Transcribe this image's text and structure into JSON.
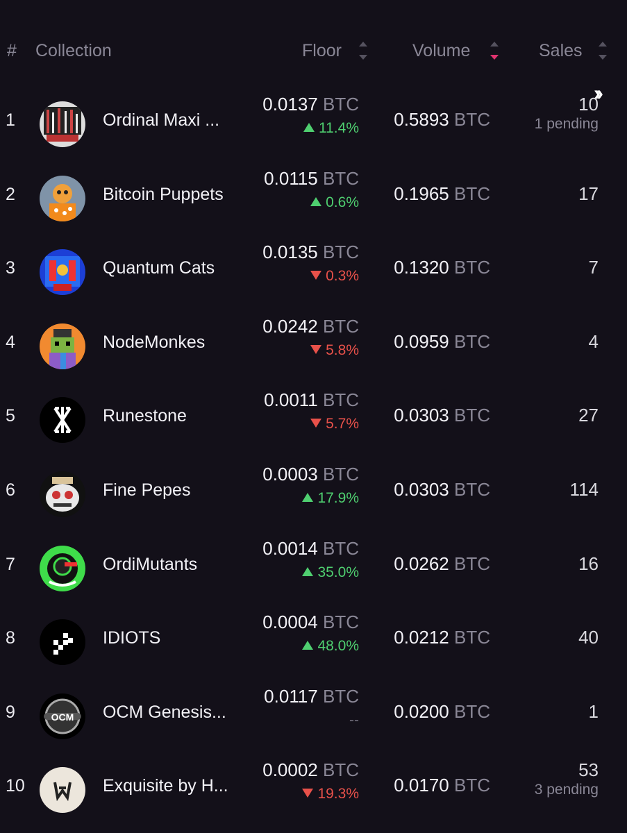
{
  "header": {
    "rank": "#",
    "collection": "Collection",
    "floor": "Floor",
    "volume": "Volume",
    "sales": "Sales"
  },
  "expand_icon": "double-chevron-right-icon",
  "rows": [
    {
      "rank": "1",
      "name": "Ordinal Maxi ...",
      "floor_value": "0.0137",
      "floor_unit": "BTC",
      "change": "11.4%",
      "direction": "up",
      "volume_value": "0.5893",
      "volume_unit": "BTC",
      "sales": "10",
      "pending": "1 pending"
    },
    {
      "rank": "2",
      "name": "Bitcoin Puppets",
      "floor_value": "0.0115",
      "floor_unit": "BTC",
      "change": "0.6%",
      "direction": "up",
      "volume_value": "0.1965",
      "volume_unit": "BTC",
      "sales": "17",
      "pending": ""
    },
    {
      "rank": "3",
      "name": "Quantum Cats",
      "floor_value": "0.0135",
      "floor_unit": "BTC",
      "change": "0.3%",
      "direction": "down",
      "volume_value": "0.1320",
      "volume_unit": "BTC",
      "sales": "7",
      "pending": ""
    },
    {
      "rank": "4",
      "name": "NodeMonkes",
      "floor_value": "0.0242",
      "floor_unit": "BTC",
      "change": "5.8%",
      "direction": "down",
      "volume_value": "0.0959",
      "volume_unit": "BTC",
      "sales": "4",
      "pending": ""
    },
    {
      "rank": "5",
      "name": "Runestone",
      "floor_value": "0.0011",
      "floor_unit": "BTC",
      "change": "5.7%",
      "direction": "down",
      "volume_value": "0.0303",
      "volume_unit": "BTC",
      "sales": "27",
      "pending": ""
    },
    {
      "rank": "6",
      "name": "Fine Pepes",
      "floor_value": "0.0003",
      "floor_unit": "BTC",
      "change": "17.9%",
      "direction": "up",
      "volume_value": "0.0303",
      "volume_unit": "BTC",
      "sales": "114",
      "pending": ""
    },
    {
      "rank": "7",
      "name": "OrdiMutants",
      "floor_value": "0.0014",
      "floor_unit": "BTC",
      "change": "35.0%",
      "direction": "up",
      "volume_value": "0.0262",
      "volume_unit": "BTC",
      "sales": "16",
      "pending": ""
    },
    {
      "rank": "8",
      "name": "IDIOTS",
      "floor_value": "0.0004",
      "floor_unit": "BTC",
      "change": "48.0%",
      "direction": "up",
      "volume_value": "0.0212",
      "volume_unit": "BTC",
      "sales": "40",
      "pending": ""
    },
    {
      "rank": "9",
      "name": "OCM Genesis...",
      "floor_value": "0.0117",
      "floor_unit": "BTC",
      "change": "--",
      "direction": "none",
      "volume_value": "0.0200",
      "volume_unit": "BTC",
      "sales": "1",
      "pending": ""
    },
    {
      "rank": "10",
      "name": "Exquisite by H...",
      "floor_value": "0.0002",
      "floor_unit": "BTC",
      "change": "19.3%",
      "direction": "down",
      "volume_value": "0.0170",
      "volume_unit": "BTC",
      "sales": "53",
      "pending": "3 pending"
    }
  ],
  "colors": {
    "background": "#131019",
    "positive": "#4fcf70",
    "negative": "#e8514a",
    "sort_active": "#e0336f",
    "muted": "#8a8796"
  }
}
